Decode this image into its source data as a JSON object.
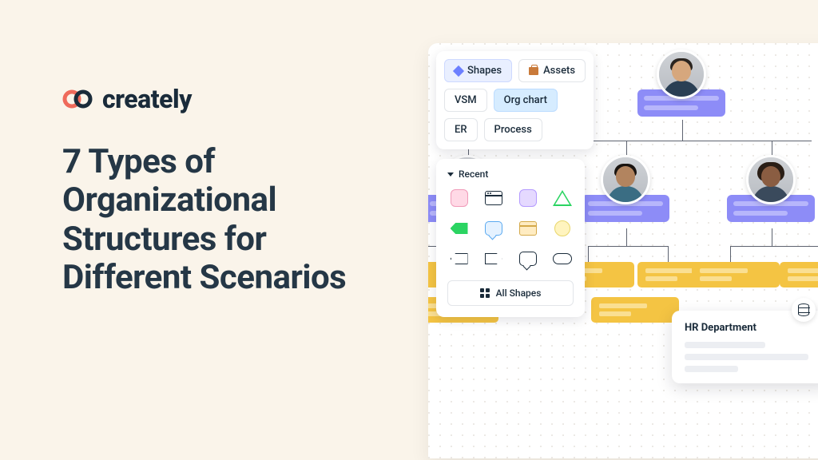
{
  "brand": {
    "name": "creately"
  },
  "title": "7 Types of Organizational Structures for Different Scenarios",
  "panel": {
    "tabs_primary": {
      "shapes": "Shapes",
      "assets": "Assets"
    },
    "tabs_secondary": {
      "vsm": "VSM",
      "org_chart": "Org chart",
      "er": "ER",
      "process": "Process"
    }
  },
  "shapes": {
    "recent_label": "Recent",
    "all_label": "All Shapes"
  },
  "hr_card": {
    "title": "HR Department"
  },
  "colors": {
    "accent": "#8d8cf7",
    "yellow": "#f4c443"
  }
}
